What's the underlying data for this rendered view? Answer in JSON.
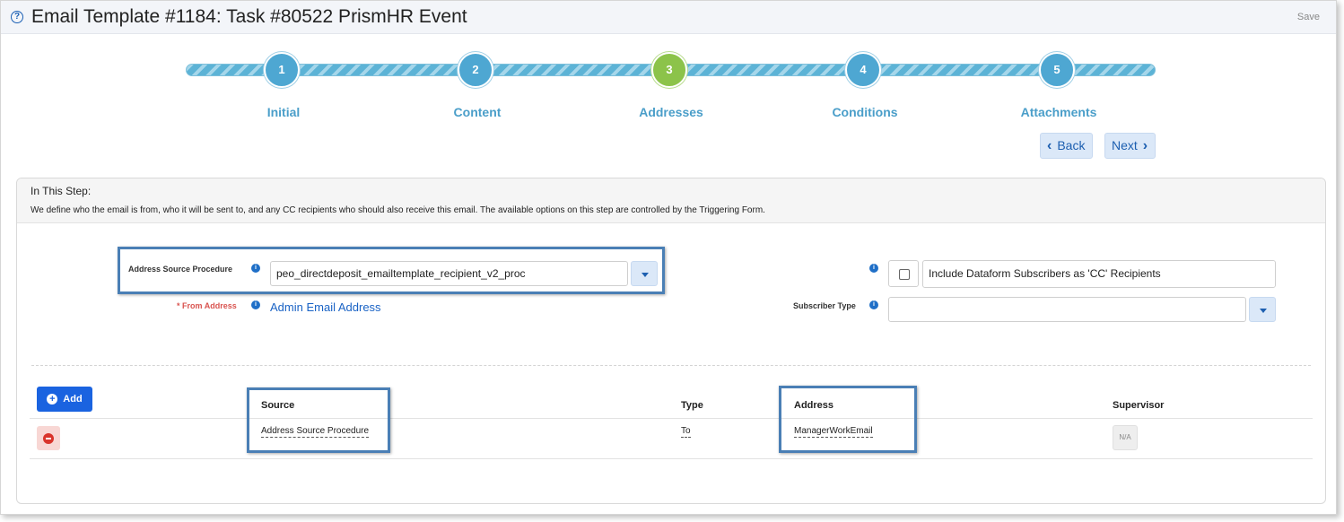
{
  "header": {
    "title": "Email Template #1184: Task #80522 PrismHR Event",
    "help_icon": "question-circle-icon",
    "save_label": "Save"
  },
  "wizard": {
    "steps": [
      {
        "number": "1",
        "label": "Initial",
        "state": "complete"
      },
      {
        "number": "2",
        "label": "Content",
        "state": "complete"
      },
      {
        "number": "3",
        "label": "Addresses",
        "state": "current"
      },
      {
        "number": "4",
        "label": "Conditions",
        "state": "pending"
      },
      {
        "number": "5",
        "label": "Attachments",
        "state": "pending"
      }
    ],
    "back_label": "Back",
    "next_label": "Next",
    "active_color": "#8cc34a",
    "step_color": "#4ea7d2"
  },
  "panel": {
    "heading": "In This Step:",
    "description": "We define who the email is from, who it will be sent to, and any CC recipients who should also receive this email. The available options on this step are controlled by the Triggering Form."
  },
  "form": {
    "address_source_label": "Address Source Procedure",
    "address_source_value": "peo_directdeposit_emailtemplate_recipient_v2_proc",
    "from_required_mark": "*",
    "from_label": "From Address",
    "from_value": "Admin Email Address",
    "include_subscribers_label": "Include Dataform Subscribers as 'CC' Recipients",
    "include_subscribers_checked": false,
    "subscriber_type_label": "Subscriber Type",
    "subscriber_type_value": ""
  },
  "table": {
    "add_label": "Add",
    "columns": [
      "Source",
      "Type",
      "Address",
      "Supervisor"
    ],
    "rows": [
      {
        "source": "Address Source Procedure",
        "type": "To",
        "address": "ManagerWorkEmail",
        "supervisor": "N/A"
      }
    ]
  },
  "colors": {
    "accent": "#1a63e0",
    "link": "#1a63c5",
    "required": "#d9534f",
    "highlight_border": "#4a7fb5"
  }
}
